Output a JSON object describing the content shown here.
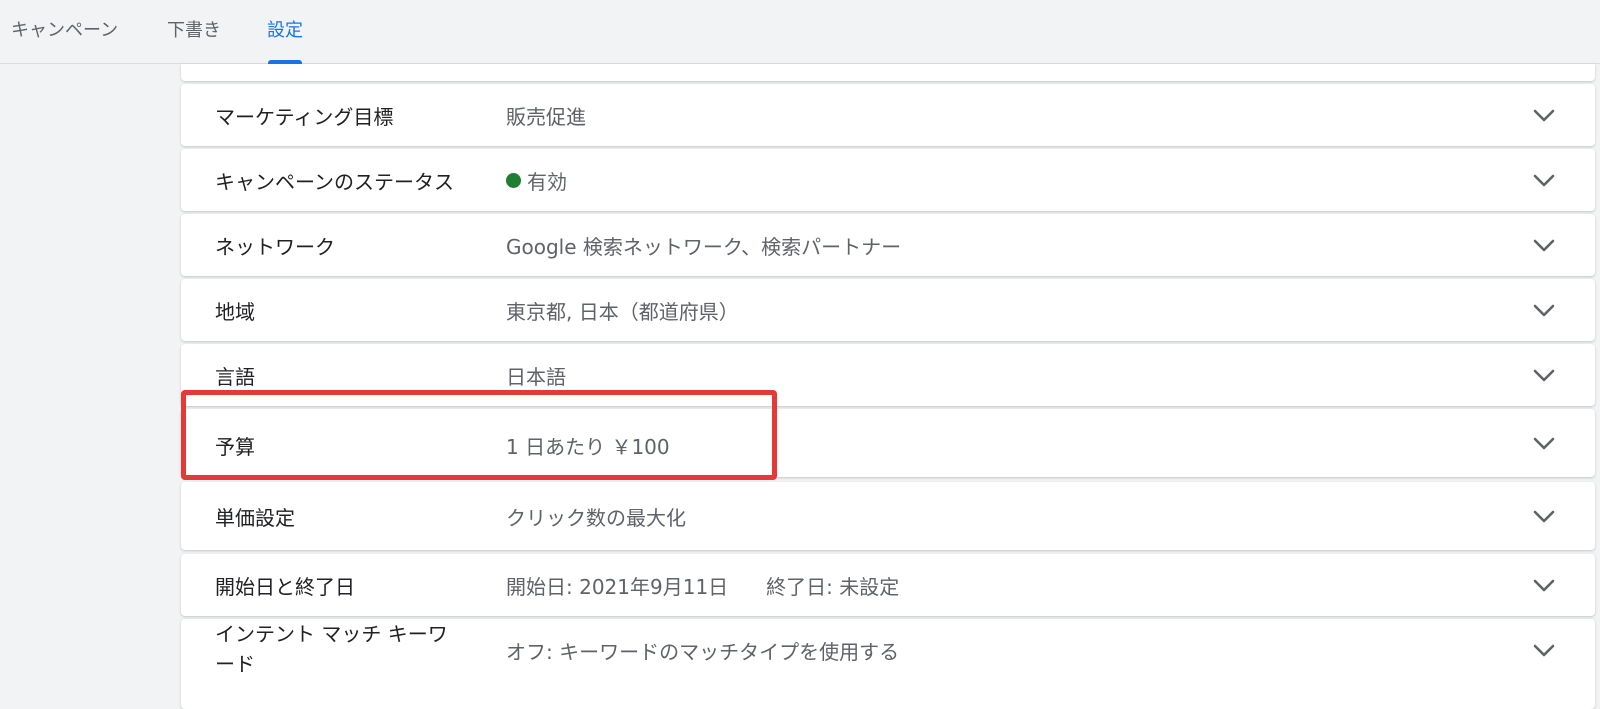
{
  "tabs": [
    {
      "label": "キャンペーン",
      "active": false
    },
    {
      "label": "下書き",
      "active": false
    },
    {
      "label": "設定",
      "active": true
    }
  ],
  "settings": {
    "rows": [
      {
        "label": "マーケティング目標",
        "value": "販売促進"
      },
      {
        "label": "キャンペーンのステータス",
        "value": "有効",
        "status_color": "#1e7e34"
      },
      {
        "label": "ネットワーク",
        "value": "Google 検索ネットワーク、検索パートナー"
      },
      {
        "label": "地域",
        "value": "東京都, 日本（都道府県）"
      },
      {
        "label": "言語",
        "value": "日本語"
      },
      {
        "label": "予算",
        "value": "1 日あたり ￥100"
      },
      {
        "label": "単価設定",
        "value": "クリック数の最大化"
      },
      {
        "label": "開始日と終了日",
        "start": "開始日: 2021年9月11日",
        "end": "終了日: 未設定"
      },
      {
        "label_line1": "インテント マッチ キーワ",
        "label_line2": "ード",
        "value": "オフ: キーワードのマッチタイプを使用する"
      }
    ],
    "expand_icon": "chevron-down-icon"
  },
  "colors": {
    "accent": "#1a73e8",
    "highlight": "#e53935",
    "active_status": "#1e7e34"
  }
}
